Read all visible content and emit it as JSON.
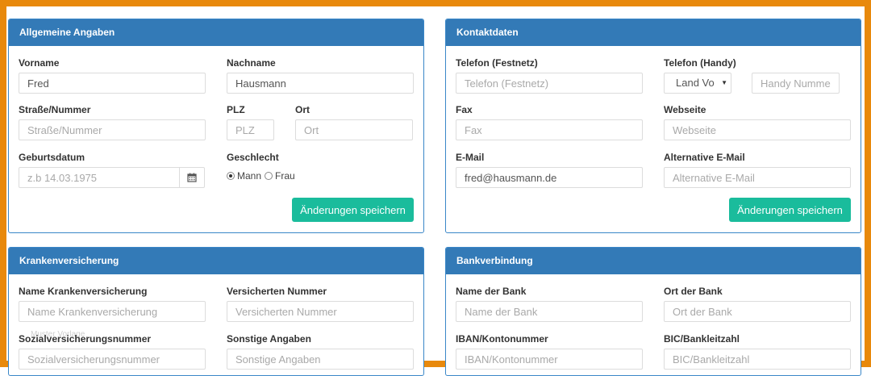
{
  "save_label": "Änderungen speichern",
  "allgemein": {
    "title": "Allgemeine Angaben",
    "vorname_label": "Vorname",
    "vorname_value": "Fred",
    "nachname_label": "Nachname",
    "nachname_value": "Hausmann",
    "strasse_label": "Straße/Nummer",
    "strasse_placeholder": "Straße/Nummer",
    "plz_label": "PLZ",
    "plz_placeholder": "PLZ",
    "ort_label": "Ort",
    "ort_placeholder": "Ort",
    "geburtsdatum_label": "Geburtsdatum",
    "geburtsdatum_placeholder": "z.b 14.03.1975",
    "geschlecht_label": "Geschlecht",
    "geschlecht_options": [
      "Mann",
      "Frau"
    ],
    "geschlecht_selected": "Mann"
  },
  "kontakt": {
    "title": "Kontaktdaten",
    "festnetz_label": "Telefon (Festnetz)",
    "festnetz_placeholder": "Telefon (Festnetz)",
    "handy_label": "Telefon (Handy)",
    "land_value": "Land Vo",
    "handy_placeholder": "Handy Nummer",
    "fax_label": "Fax",
    "fax_placeholder": "Fax",
    "webseite_label": "Webseite",
    "webseite_placeholder": "Webseite",
    "email_label": "E-Mail",
    "email_value": "fred@hausmann.de",
    "alt_email_label": "Alternative E-Mail",
    "alt_email_placeholder": "Alternative E-Mail"
  },
  "kranken": {
    "title": "Krankenversicherung",
    "name_label": "Name Krankenversicherung",
    "name_placeholder": "Name Krankenversicherung",
    "nummer_label": "Versicherten Nummer",
    "nummer_placeholder": "Versicherten Nummer",
    "sv_label": "Sozialversicherungsnummer",
    "sv_placeholder": "Sozialversicherungsnummer",
    "sonstige_label": "Sonstige Angaben",
    "sonstige_placeholder": "Sonstige Angaben",
    "ghost_text": "Muster Vorlage"
  },
  "bank": {
    "title": "Bankverbindung",
    "name_label": "Name der Bank",
    "name_placeholder": "Name der Bank",
    "ort_label": "Ort der Bank",
    "ort_placeholder": "Ort der Bank",
    "iban_label": "IBAN/Kontonummer",
    "iban_placeholder": "IBAN/Kontonummer",
    "bic_label": "BIC/Bankleitzahl",
    "bic_placeholder": "BIC/Bankleitzahl"
  },
  "colors": {
    "frame": "#e8890c",
    "heading": "#337ab7",
    "button": "#1abc9c"
  }
}
